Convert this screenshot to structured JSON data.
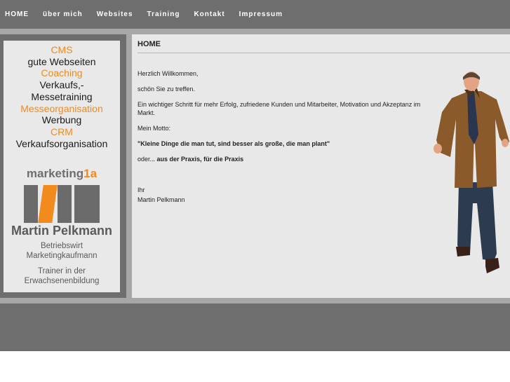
{
  "nav": [
    "HOME",
    "über mich",
    "Websites",
    "Training",
    "Kontakt",
    "Impressum"
  ],
  "sidebar": {
    "services": [
      {
        "text": "CMS",
        "highlight": true
      },
      {
        "text": "gute Webseiten",
        "highlight": false
      },
      {
        "text": "Coaching",
        "highlight": true
      },
      {
        "text": "Verkaufs,-",
        "highlight": false
      },
      {
        "text": "Messetraining",
        "highlight": false
      },
      {
        "text": "Messeorganisation",
        "highlight": true
      },
      {
        "text": "Werbung",
        "highlight": false
      },
      {
        "text": "CRM",
        "highlight": true
      },
      {
        "text": "Verkaufsorganisation",
        "highlight": false
      }
    ],
    "logo_word": "marketing",
    "logo_suffix": "1a",
    "name": "Martin Pelkmann",
    "title_line1": "Betriebswirt",
    "title_line2": "Marketingkaufmann",
    "trainer_line1": "Trainer in der",
    "trainer_line2": "Erwachsenenbildung"
  },
  "main": {
    "heading": "HOME",
    "greeting": "Herzlich Willkommen,",
    "line2": "schön Sie zu treffen.",
    "line3": "Ein wichtiger Schritt für mehr Erfolg, zufriedene Kunden und Mitarbeiter, Motivation und Akzeptanz im Markt.",
    "motto_label": "Mein Motto:",
    "motto": "\"Kleine Dinge die man tut, sind besser als große, die man plant\"",
    "or_prefix": "oder... ",
    "or_bold": "aus der Praxis, für die Praxis",
    "sign1": "Ihr",
    "sign2": "Martin Pelkmann"
  },
  "colors": {
    "accent": "#f28a1e",
    "bar": "#6e6e6e",
    "band": "#a7a7a7",
    "panel": "#e8e8e8"
  },
  "icons": [
    "person-photo",
    "logo-bars"
  ]
}
